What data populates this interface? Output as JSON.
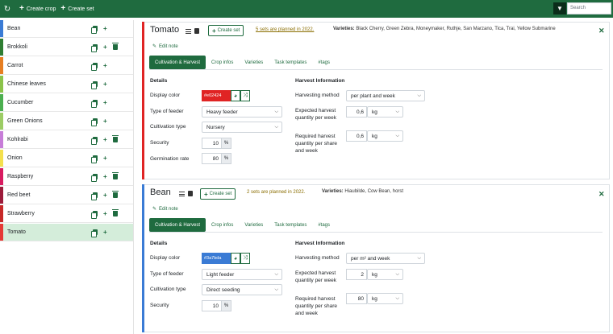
{
  "topbar": {
    "create_crop_label": "Create crop",
    "create_set_label": "Create set",
    "search_placeholder": "Search"
  },
  "sidebar": {
    "crops": [
      {
        "name": "Bean",
        "color": "#3a7bd5",
        "active": false,
        "deletable": false
      },
      {
        "name": "Brokkoli",
        "color": "#2e7d32",
        "active": false,
        "deletable": true
      },
      {
        "name": "Carrot",
        "color": "#e67e22",
        "active": false,
        "deletable": false
      },
      {
        "name": "Chinese leaves",
        "color": "#8bc34a",
        "active": false,
        "deletable": false
      },
      {
        "name": "Cucumber",
        "color": "#4caf50",
        "active": false,
        "deletable": false
      },
      {
        "name": "Green Onions",
        "color": "#9ccc65",
        "active": false,
        "deletable": false
      },
      {
        "name": "Kohlrabi",
        "color": "#c77dd8",
        "active": false,
        "deletable": true
      },
      {
        "name": "Onion",
        "color": "#f4e04d",
        "active": false,
        "deletable": false
      },
      {
        "name": "Raspberry",
        "color": "#d81b60",
        "active": false,
        "deletable": true
      },
      {
        "name": "Red beet",
        "color": "#9c1b3a",
        "active": false,
        "deletable": true
      },
      {
        "name": "Strawberry",
        "color": "#c62828",
        "active": false,
        "deletable": true
      },
      {
        "name": "Tomato",
        "color": "#e53935",
        "active": true,
        "deletable": false
      }
    ]
  },
  "cards": [
    {
      "name": "Tomato",
      "color": "#e02424",
      "create_set_label": "Create set",
      "planned": "5 sets are planned in 2022.",
      "varieties_label": "Varieties:",
      "varieties": "Black Cherry, Green Zebra, Moneymaker, Ruthje, San Marzano, Tica, Trai, Yellow Submarine",
      "edit_note": "Edit note",
      "tabs": [
        "Cultivation & Harvest",
        "Crop infos",
        "Varieties",
        "Task templates",
        "#tags"
      ],
      "details_title": "Details",
      "display_color_label": "Display color",
      "display_color_value": "#e02424",
      "feeder_label": "Type of feeder",
      "feeder_value": "Heavy feeder",
      "cultivation_label": "Cultivation type",
      "cultivation_value": "Nursery",
      "security_label": "Security",
      "security_value": "10",
      "security_unit": "%",
      "germination_label": "Germination rate",
      "germination_value": "80",
      "germination_unit": "%",
      "harvest_title": "Harvest Information",
      "harvest_method_label": "Harvesting method",
      "harvest_method_value": "per plant and week",
      "expected_label_1": "Expected harvest",
      "expected_label_2": "quantity per week",
      "expected_value": "0,6",
      "expected_unit": "kg",
      "required_label_1": "Required harvest",
      "required_label_2": "quantity per share",
      "required_label_3": "and week",
      "required_value": "0,6",
      "required_unit": "kg"
    },
    {
      "name": "Bean",
      "color": "#3a7bd5",
      "create_set_label": "Create set",
      "planned": "2 sets are planned in 2022.",
      "varieties_label": "Varieties:",
      "varieties": "Hiaubilde, Cow Bean, horst",
      "edit_note": "Edit note",
      "tabs": [
        "Cultivation & Harvest",
        "Crop infos",
        "Varieties",
        "Task templates",
        "#tags"
      ],
      "details_title": "Details",
      "display_color_label": "Display color",
      "display_color_value": "#3a7bda",
      "feeder_label": "Type of feeder",
      "feeder_value": "Light feeder",
      "cultivation_label": "Cultivation type",
      "cultivation_value": "Direct seeding",
      "security_label": "Security",
      "security_value": "10",
      "security_unit": "%",
      "harvest_title": "Harvest Information",
      "harvest_method_label": "Harvesting method",
      "harvest_method_value": "per m² and week",
      "expected_label_1": "Expected harvest",
      "expected_label_2": "quantity per week",
      "expected_value": "2",
      "expected_unit": "kg",
      "required_label_1": "Required harvest",
      "required_label_2": "quantity per share",
      "required_label_3": "and week",
      "required_value": "80",
      "required_unit": "kg"
    }
  ]
}
